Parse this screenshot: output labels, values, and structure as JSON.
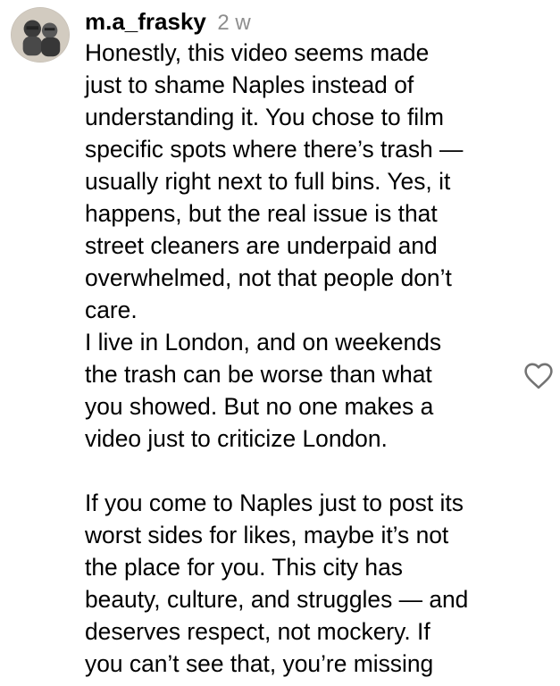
{
  "comment": {
    "username": "m.a_frasky",
    "timestamp": "2 w",
    "lines": [
      "Honestly, this video seems made",
      "just to shame Naples instead of",
      "understanding it. You chose to film",
      "specific spots where there’s trash —",
      "usually right next to full bins. Yes, it",
      "happens, but the real issue is that",
      "street cleaners are underpaid and",
      "overwhelmed, not that people don’t",
      "care.",
      "I live in London, and on weekends",
      "the trash can be worse than what",
      "you showed. But no one makes a",
      "video just to criticize London.",
      "",
      "If you come to Naples just to post its",
      "worst sides for likes, maybe it’s not",
      "the place for you. This city has",
      "beauty, culture, and struggles — and",
      "deserves respect, not mockery. If",
      "you can’t see that, you’re missing"
    ],
    "avatar_icon": "profile-photo",
    "like_icon": "heart-outline-icon",
    "colors": {
      "text": "#000000",
      "timestamp": "#8e8e8e",
      "icon": "#737373"
    }
  }
}
